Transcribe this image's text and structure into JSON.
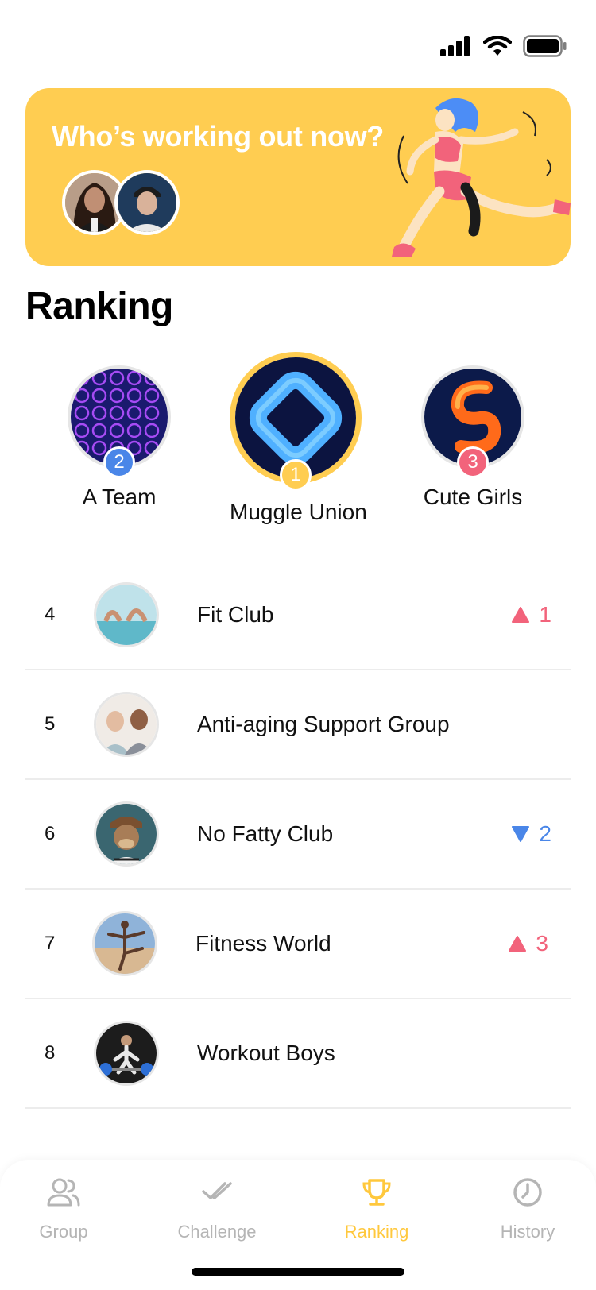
{
  "colors": {
    "accent": "#FFC83D",
    "banner": "#FFCD51",
    "rank_up": "#F2637B",
    "rank_down": "#4A86E8",
    "tab_inactive": "#B5B5B5"
  },
  "status_bar": {
    "icons": [
      "signal-icon",
      "wifi-icon",
      "battery-icon"
    ]
  },
  "banner": {
    "title": "Who’s working out now?",
    "avatars": [
      "avatar-woman",
      "avatar-man"
    ]
  },
  "ranking": {
    "title": "Ranking",
    "podium": [
      {
        "rank": "2",
        "name": "A Team",
        "badge_color": "#4A86E8"
      },
      {
        "rank": "1",
        "name": "Muggle Union",
        "badge_color": "#FFCD51"
      },
      {
        "rank": "3",
        "name": "Cute Girls",
        "badge_color": "#F2637B"
      }
    ],
    "list": [
      {
        "rank": "4",
        "name": "Fit Club",
        "change": "1",
        "direction": "up"
      },
      {
        "rank": "5",
        "name": "Anti-aging Support Group",
        "change": "",
        "direction": "none"
      },
      {
        "rank": "6",
        "name": "No Fatty Club",
        "change": "2",
        "direction": "down"
      },
      {
        "rank": "7",
        "name": "Fitness World",
        "change": "3",
        "direction": "up"
      },
      {
        "rank": "8",
        "name": "Workout Boys",
        "change": "",
        "direction": "none"
      }
    ]
  },
  "tab_bar": {
    "tabs": [
      {
        "label": "Group",
        "icon": "users-icon",
        "active": false
      },
      {
        "label": "Challenge",
        "icon": "double-check-icon",
        "active": false
      },
      {
        "label": "Ranking",
        "icon": "trophy-icon",
        "active": true
      },
      {
        "label": "History",
        "icon": "clock-icon",
        "active": false
      }
    ]
  }
}
